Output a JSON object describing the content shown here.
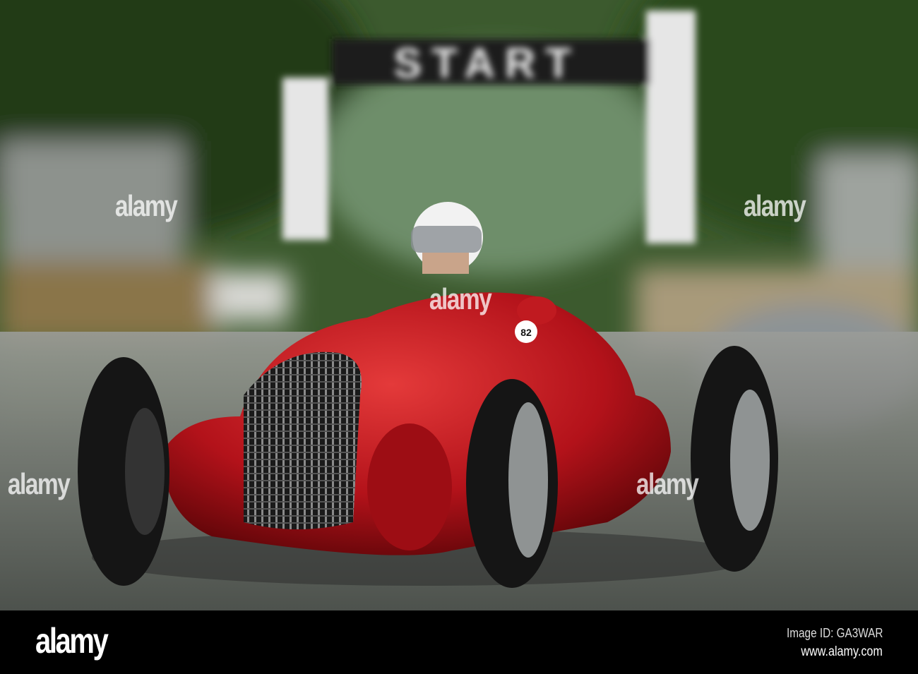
{
  "photo": {
    "gantry_text": "START",
    "car_number": "82",
    "watermark": "alamy"
  },
  "footer": {
    "logo": "alamy",
    "image_id": "Image ID: GA3WAR",
    "website": "www.alamy.com"
  },
  "colors": {
    "car_red": "#b3121a",
    "foliage": "#2f4a22",
    "road": "#6a6c6c"
  }
}
